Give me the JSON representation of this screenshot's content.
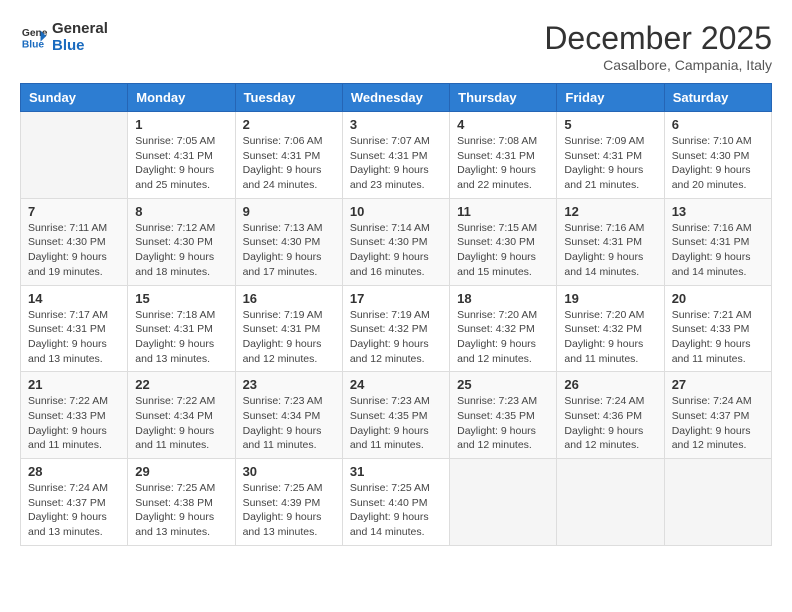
{
  "logo": {
    "line1": "General",
    "line2": "Blue"
  },
  "title": "December 2025",
  "location": "Casalbore, Campania, Italy",
  "weekdays": [
    "Sunday",
    "Monday",
    "Tuesday",
    "Wednesday",
    "Thursday",
    "Friday",
    "Saturday"
  ],
  "weeks": [
    [
      {
        "day": "",
        "sunrise": "",
        "sunset": "",
        "daylight": ""
      },
      {
        "day": "1",
        "sunrise": "Sunrise: 7:05 AM",
        "sunset": "Sunset: 4:31 PM",
        "daylight": "Daylight: 9 hours and 25 minutes."
      },
      {
        "day": "2",
        "sunrise": "Sunrise: 7:06 AM",
        "sunset": "Sunset: 4:31 PM",
        "daylight": "Daylight: 9 hours and 24 minutes."
      },
      {
        "day": "3",
        "sunrise": "Sunrise: 7:07 AM",
        "sunset": "Sunset: 4:31 PM",
        "daylight": "Daylight: 9 hours and 23 minutes."
      },
      {
        "day": "4",
        "sunrise": "Sunrise: 7:08 AM",
        "sunset": "Sunset: 4:31 PM",
        "daylight": "Daylight: 9 hours and 22 minutes."
      },
      {
        "day": "5",
        "sunrise": "Sunrise: 7:09 AM",
        "sunset": "Sunset: 4:31 PM",
        "daylight": "Daylight: 9 hours and 21 minutes."
      },
      {
        "day": "6",
        "sunrise": "Sunrise: 7:10 AM",
        "sunset": "Sunset: 4:30 PM",
        "daylight": "Daylight: 9 hours and 20 minutes."
      }
    ],
    [
      {
        "day": "7",
        "sunrise": "Sunrise: 7:11 AM",
        "sunset": "Sunset: 4:30 PM",
        "daylight": "Daylight: 9 hours and 19 minutes."
      },
      {
        "day": "8",
        "sunrise": "Sunrise: 7:12 AM",
        "sunset": "Sunset: 4:30 PM",
        "daylight": "Daylight: 9 hours and 18 minutes."
      },
      {
        "day": "9",
        "sunrise": "Sunrise: 7:13 AM",
        "sunset": "Sunset: 4:30 PM",
        "daylight": "Daylight: 9 hours and 17 minutes."
      },
      {
        "day": "10",
        "sunrise": "Sunrise: 7:14 AM",
        "sunset": "Sunset: 4:30 PM",
        "daylight": "Daylight: 9 hours and 16 minutes."
      },
      {
        "day": "11",
        "sunrise": "Sunrise: 7:15 AM",
        "sunset": "Sunset: 4:30 PM",
        "daylight": "Daylight: 9 hours and 15 minutes."
      },
      {
        "day": "12",
        "sunrise": "Sunrise: 7:16 AM",
        "sunset": "Sunset: 4:31 PM",
        "daylight": "Daylight: 9 hours and 14 minutes."
      },
      {
        "day": "13",
        "sunrise": "Sunrise: 7:16 AM",
        "sunset": "Sunset: 4:31 PM",
        "daylight": "Daylight: 9 hours and 14 minutes."
      }
    ],
    [
      {
        "day": "14",
        "sunrise": "Sunrise: 7:17 AM",
        "sunset": "Sunset: 4:31 PM",
        "daylight": "Daylight: 9 hours and 13 minutes."
      },
      {
        "day": "15",
        "sunrise": "Sunrise: 7:18 AM",
        "sunset": "Sunset: 4:31 PM",
        "daylight": "Daylight: 9 hours and 13 minutes."
      },
      {
        "day": "16",
        "sunrise": "Sunrise: 7:19 AM",
        "sunset": "Sunset: 4:31 PM",
        "daylight": "Daylight: 9 hours and 12 minutes."
      },
      {
        "day": "17",
        "sunrise": "Sunrise: 7:19 AM",
        "sunset": "Sunset: 4:32 PM",
        "daylight": "Daylight: 9 hours and 12 minutes."
      },
      {
        "day": "18",
        "sunrise": "Sunrise: 7:20 AM",
        "sunset": "Sunset: 4:32 PM",
        "daylight": "Daylight: 9 hours and 12 minutes."
      },
      {
        "day": "19",
        "sunrise": "Sunrise: 7:20 AM",
        "sunset": "Sunset: 4:32 PM",
        "daylight": "Daylight: 9 hours and 11 minutes."
      },
      {
        "day": "20",
        "sunrise": "Sunrise: 7:21 AM",
        "sunset": "Sunset: 4:33 PM",
        "daylight": "Daylight: 9 hours and 11 minutes."
      }
    ],
    [
      {
        "day": "21",
        "sunrise": "Sunrise: 7:22 AM",
        "sunset": "Sunset: 4:33 PM",
        "daylight": "Daylight: 9 hours and 11 minutes."
      },
      {
        "day": "22",
        "sunrise": "Sunrise: 7:22 AM",
        "sunset": "Sunset: 4:34 PM",
        "daylight": "Daylight: 9 hours and 11 minutes."
      },
      {
        "day": "23",
        "sunrise": "Sunrise: 7:23 AM",
        "sunset": "Sunset: 4:34 PM",
        "daylight": "Daylight: 9 hours and 11 minutes."
      },
      {
        "day": "24",
        "sunrise": "Sunrise: 7:23 AM",
        "sunset": "Sunset: 4:35 PM",
        "daylight": "Daylight: 9 hours and 11 minutes."
      },
      {
        "day": "25",
        "sunrise": "Sunrise: 7:23 AM",
        "sunset": "Sunset: 4:35 PM",
        "daylight": "Daylight: 9 hours and 12 minutes."
      },
      {
        "day": "26",
        "sunrise": "Sunrise: 7:24 AM",
        "sunset": "Sunset: 4:36 PM",
        "daylight": "Daylight: 9 hours and 12 minutes."
      },
      {
        "day": "27",
        "sunrise": "Sunrise: 7:24 AM",
        "sunset": "Sunset: 4:37 PM",
        "daylight": "Daylight: 9 hours and 12 minutes."
      }
    ],
    [
      {
        "day": "28",
        "sunrise": "Sunrise: 7:24 AM",
        "sunset": "Sunset: 4:37 PM",
        "daylight": "Daylight: 9 hours and 13 minutes."
      },
      {
        "day": "29",
        "sunrise": "Sunrise: 7:25 AM",
        "sunset": "Sunset: 4:38 PM",
        "daylight": "Daylight: 9 hours and 13 minutes."
      },
      {
        "day": "30",
        "sunrise": "Sunrise: 7:25 AM",
        "sunset": "Sunset: 4:39 PM",
        "daylight": "Daylight: 9 hours and 13 minutes."
      },
      {
        "day": "31",
        "sunrise": "Sunrise: 7:25 AM",
        "sunset": "Sunset: 4:40 PM",
        "daylight": "Daylight: 9 hours and 14 minutes."
      },
      {
        "day": "",
        "sunrise": "",
        "sunset": "",
        "daylight": ""
      },
      {
        "day": "",
        "sunrise": "",
        "sunset": "",
        "daylight": ""
      },
      {
        "day": "",
        "sunrise": "",
        "sunset": "",
        "daylight": ""
      }
    ]
  ]
}
